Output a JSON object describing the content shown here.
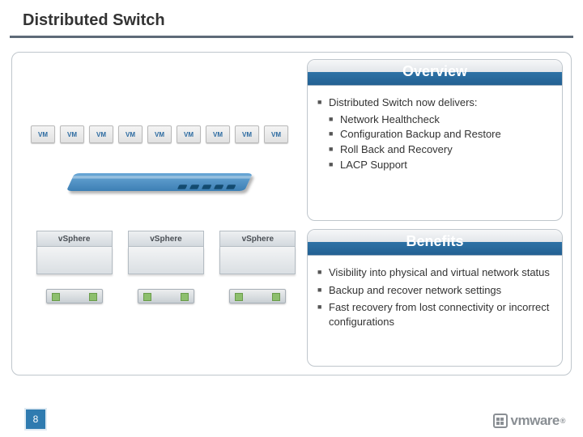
{
  "title": "Distributed Switch",
  "page_number": "8",
  "brand": {
    "name": "vmware",
    "reg": "®"
  },
  "diagram": {
    "vm_label": "VM",
    "vm_count": 9,
    "host_label": "vSphere",
    "host_count": 3,
    "server_count": 3
  },
  "panels": {
    "overview": {
      "title": "Overview",
      "lead": "Distributed Switch now delivers:",
      "items": [
        "Network Healthcheck",
        "Configuration Backup and Restore",
        "Roll Back and Recovery",
        "LACP Support"
      ]
    },
    "benefits": {
      "title": "Benefits",
      "items": [
        "Visibility into physical and virtual network status",
        "Backup and recover network settings",
        "Fast recovery from lost connectivity or incorrect configurations"
      ]
    }
  }
}
